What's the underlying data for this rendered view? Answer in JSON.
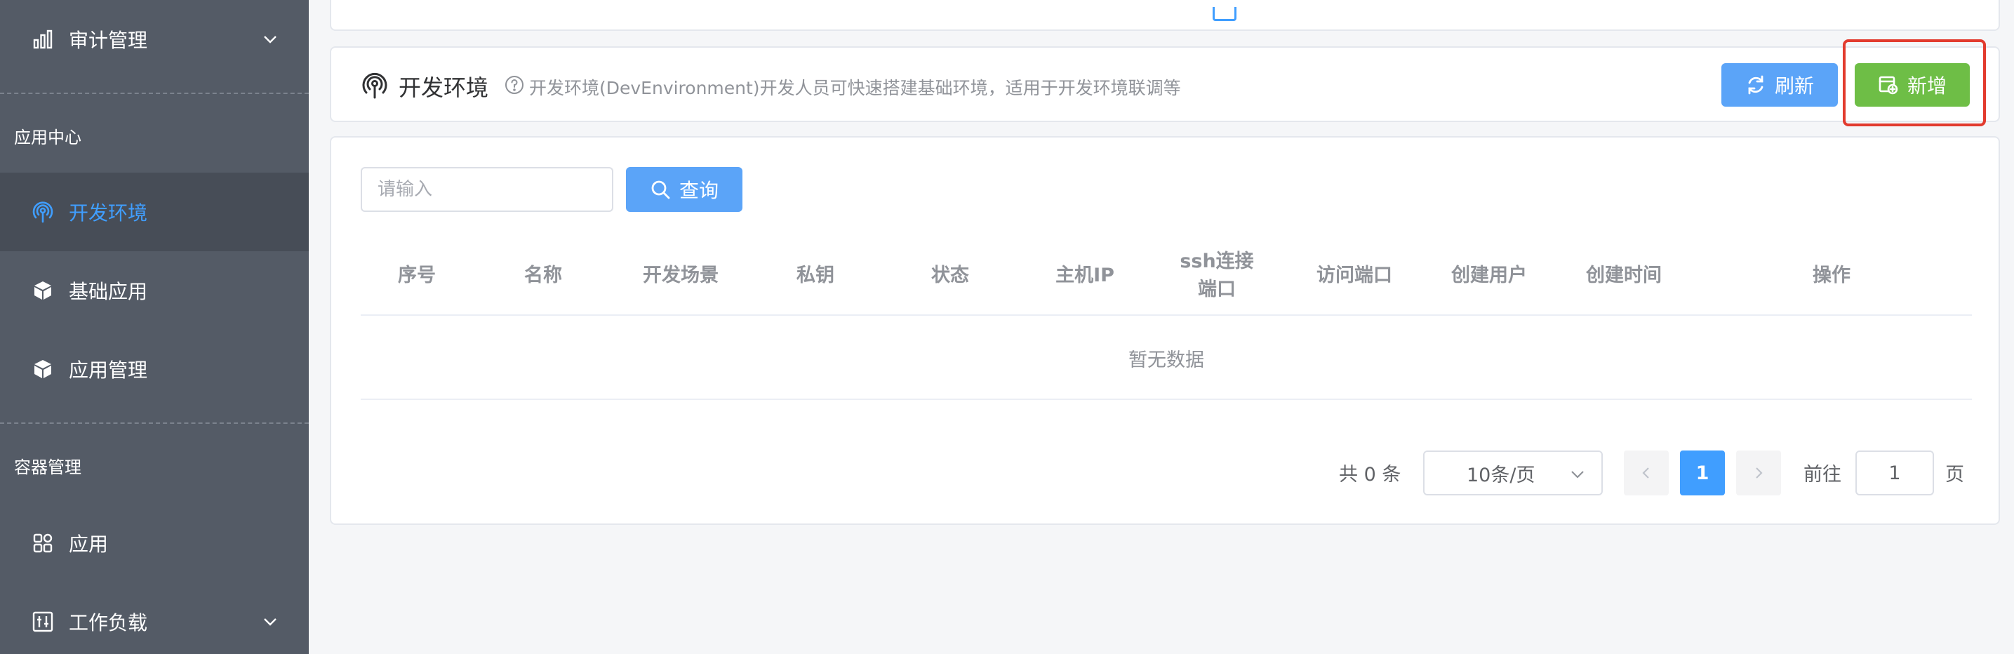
{
  "sidebar": {
    "items": [
      {
        "label": "审计管理",
        "icon": "bar-chart-icon",
        "expandable": true
      },
      {
        "label": "开发环境",
        "icon": "broadcast-icon",
        "active": true
      },
      {
        "label": "基础应用",
        "icon": "cube-icon"
      },
      {
        "label": "应用管理",
        "icon": "cube-icon"
      },
      {
        "label": "应用",
        "icon": "grid-apps-icon"
      },
      {
        "label": "工作负载",
        "icon": "sliders-icon",
        "expandable": true
      }
    ],
    "groups": [
      "应用中心",
      "容器管理"
    ]
  },
  "header": {
    "title": "开发环境",
    "description": "开发环境(DevEnvironment)开发人员可快速搭建基础环境，适用于开发环境联调等",
    "refresh_label": "刷新",
    "add_label": "新增"
  },
  "search": {
    "placeholder": "请输入",
    "button_label": "查询"
  },
  "table": {
    "columns": [
      "序号",
      "名称",
      "开发场景",
      "私钥",
      "状态",
      "主机IP",
      "ssh连接端口",
      "访问端口",
      "创建用户",
      "创建时间",
      "操作"
    ],
    "rows": [],
    "empty_text": "暂无数据"
  },
  "pagination": {
    "total_text": "共 0 条",
    "page_size": "10条/页",
    "current_page": "1",
    "goto_label": "前往",
    "goto_value": "1",
    "page_unit": "页"
  },
  "colors": {
    "sidebar_bg": "#545b66",
    "active_text": "#409eff",
    "primary_button": "#5ba4f8",
    "success_button": "#6ebe46",
    "highlight": "#e23b2e"
  }
}
